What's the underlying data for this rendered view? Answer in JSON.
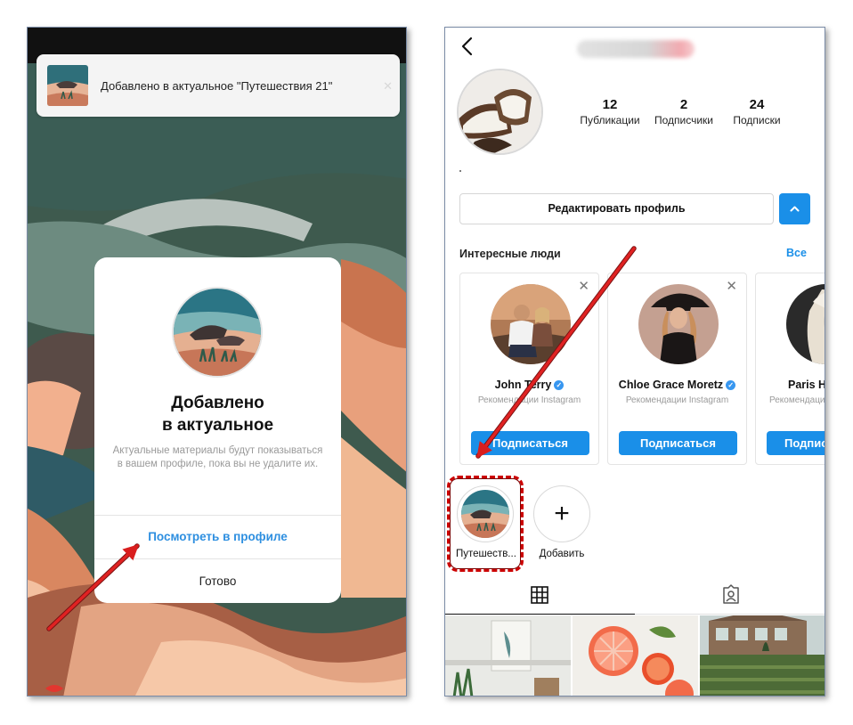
{
  "left_screen": {
    "toast": {
      "text": "Добавлено в актуальное \"Путешествия 21\"",
      "close_icon": "close-icon"
    },
    "dialog": {
      "title_line1": "Добавлено",
      "title_line2": "в актуальное",
      "description": "Актуальные материалы будут показываться в вашем профиле, пока вы не удалите их.",
      "view_in_profile": "Посмотреть в профиле",
      "done": "Готово"
    }
  },
  "right_screen": {
    "header": {
      "back_icon": "chevron-left-icon"
    },
    "stats": [
      {
        "value": "12",
        "label": "Публикации"
      },
      {
        "value": "2",
        "label": "Подписчики"
      },
      {
        "value": "24",
        "label": "Подписки"
      }
    ],
    "edit_profile": "Редактировать профиль",
    "expand_icon": "chevron-up-icon",
    "suggested": {
      "title": "Интересные люди",
      "see_all": "Все",
      "cards": [
        {
          "name": "John Terry",
          "subtitle": "Рекомендации Instagram",
          "follow": "Подписаться"
        },
        {
          "name": "Chloe Grace Moretz",
          "subtitle": "Рекомендации Instagram",
          "follow": "Подписаться"
        },
        {
          "name": "Paris Hilton",
          "subtitle": "Рекомендации Instagram",
          "follow": "Подписаться"
        }
      ]
    },
    "highlights": [
      {
        "label": "Путешеств..."
      },
      {
        "label": "Добавить"
      }
    ],
    "tabs": {
      "grid_icon": "grid-icon",
      "tagged_icon": "tagged-user-icon"
    }
  },
  "colors": {
    "accent_blue": "#1a8fe8",
    "link_blue": "#2e8fe0",
    "arrow_red": "#d91e1e",
    "dash_red": "#cc0000"
  }
}
